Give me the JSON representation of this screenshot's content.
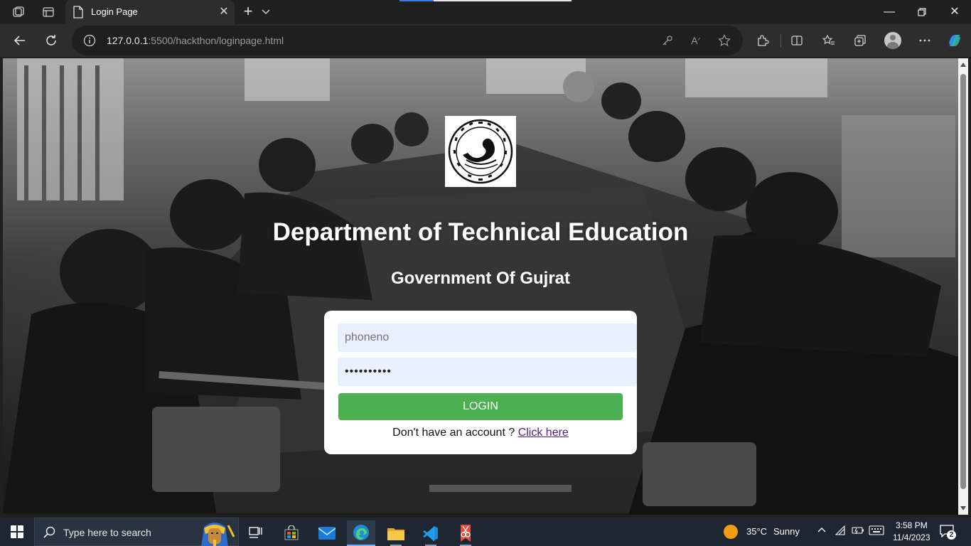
{
  "browser": {
    "tab_title": "Login Page",
    "url_host": "127.0.0.1",
    "url_rest": ":5500/hackthon/loginpage.html"
  },
  "page": {
    "title": "Department of Technical Education",
    "subtitle": "Government Of Gujrat",
    "emblem_alt": "Department emblem",
    "login": {
      "phone_placeholder": "phoneno",
      "phone_value": "",
      "password_value": "••••••••••",
      "login_button": "LOGIN",
      "signup_prompt": "Don't have an account ?",
      "signup_link": "Click here",
      "button_color": "#4caf50",
      "field_color": "#e8f0fe"
    }
  },
  "taskbar": {
    "search_placeholder": "Type here to search",
    "weather_temp": "35°C",
    "weather_desc": "Sunny",
    "time": "3:58 PM",
    "date": "11/4/2023",
    "notification_count": "2",
    "apps": [
      "task-view",
      "microsoft-store",
      "mail",
      "edge",
      "file-explorer",
      "vs-code",
      "snipping-tool"
    ]
  }
}
